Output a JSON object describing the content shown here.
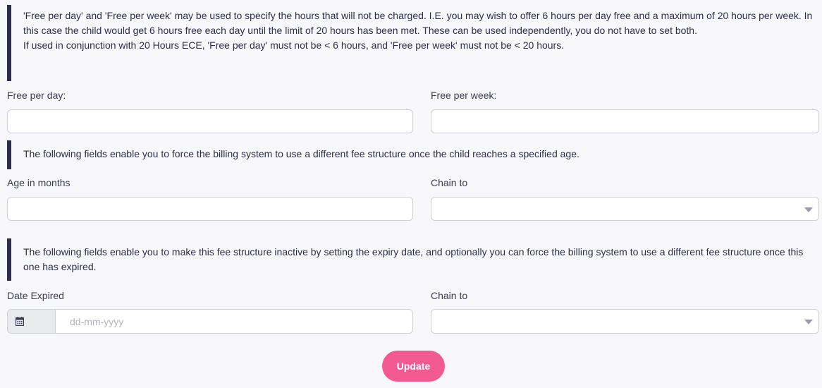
{
  "notes": {
    "free_hours": {
      "line1": "'Free per day' and 'Free per week' may be used to specify the hours that will not be charged. I.E. you may wish to offer 6 hours per day free and a maximum of 20 hours per week. In this case the child would get 6 hours free each day until the limit of 20 hours has been met. These can be used independently, you do not have to set both.",
      "line2": "If used in conjunction with 20 Hours ECE, 'Free per day' must not be < 6 hours, and 'Free per week' must not be < 20 hours."
    },
    "age_chain": "The following fields enable you to force the billing system to use a different fee structure once the child reaches a specified age.",
    "expiry": "The following fields enable you to make this fee structure inactive by setting the expiry date, and optionally you can force the billing system to use a different fee structure once this one has expired."
  },
  "fields": {
    "free_per_day": {
      "label": "Free per day:",
      "value": ""
    },
    "free_per_week": {
      "label": "Free per week:",
      "value": ""
    },
    "age_in_months": {
      "label": "Age in months",
      "value": ""
    },
    "chain_to_age": {
      "label": "Chain to",
      "value": ""
    },
    "date_expired": {
      "label": "Date Expired",
      "placeholder": "dd-mm-yyyy",
      "value": ""
    },
    "chain_to_expiry": {
      "label": "Chain to",
      "value": ""
    }
  },
  "actions": {
    "update_label": "Update"
  },
  "colors": {
    "accent": "#f45a92",
    "note_border": "#2c2d4a",
    "background": "#f8f8fa"
  }
}
